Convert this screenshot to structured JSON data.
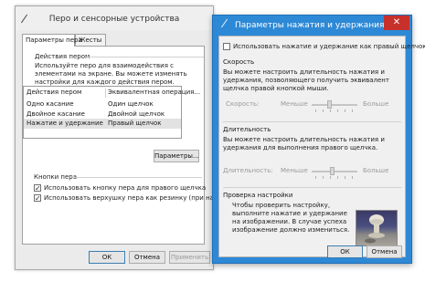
{
  "pen_window": {
    "title": "Перо и сенсорные устройства",
    "tabs": [
      {
        "label": "Параметры пера",
        "active": true
      },
      {
        "label": "Жесты",
        "active": false
      }
    ],
    "pen_actions": {
      "group_label": "Действия пером",
      "description": "Используйте перо для взаимодействия с элементами на экране. Вы можете изменять настройки для каждого действия пером.",
      "columns": [
        "Действия пером",
        "Эквивалентная операция..."
      ],
      "rows": [
        {
          "action": "Одно касание",
          "equivalent": "Один щелчок"
        },
        {
          "action": "Двойное касание",
          "equivalent": "Двойной щелчок"
        },
        {
          "action": "Нажатие и удержание",
          "equivalent": "Правый щелчок",
          "selected": true
        }
      ],
      "settings_button": "Параметры..."
    },
    "pen_buttons": {
      "group_label": "Кнопки пера",
      "options": [
        {
          "label": "Использовать кнопку пера для правого щелчка",
          "checked": true
        },
        {
          "label": "Использовать верхушку пера как резинку (при наличии)",
          "checked": true
        }
      ]
    },
    "buttons": {
      "ok": "ОК",
      "cancel": "Отмена",
      "apply": "Применить"
    }
  },
  "press_hold_window": {
    "title": "Параметры нажатия и удержания",
    "close_glyph": "✕",
    "enable": {
      "label": "Использовать нажатие и удержание как правый щелчок",
      "checked": false
    },
    "speed": {
      "label": "Скорость",
      "description": "Вы можете настроить длительность нажатия и удержания, позволяющего получить эквивалент щелчка правой кнопкой мыши.",
      "slider_caption": "Скорость:",
      "min_label": "Меньше",
      "max_label": "Больше"
    },
    "duration": {
      "label": "Длительность",
      "description": "Вы можете настроить длительность нажатия и удержания для выполнения правого щелчка.",
      "slider_caption": "Длительность:",
      "min_label": "Меньше",
      "max_label": "Больше"
    },
    "test": {
      "label": "Проверка настройки",
      "description": "Чтобы проверить настройку, выполните нажатие и удержание на изображении. В случае успеха изображение должно измениться."
    },
    "buttons": {
      "ok": "ОК",
      "cancel": "Отмена"
    }
  },
  "colors": {
    "titlebar_active": "#2d89d6",
    "close_button": "#c7302b"
  }
}
